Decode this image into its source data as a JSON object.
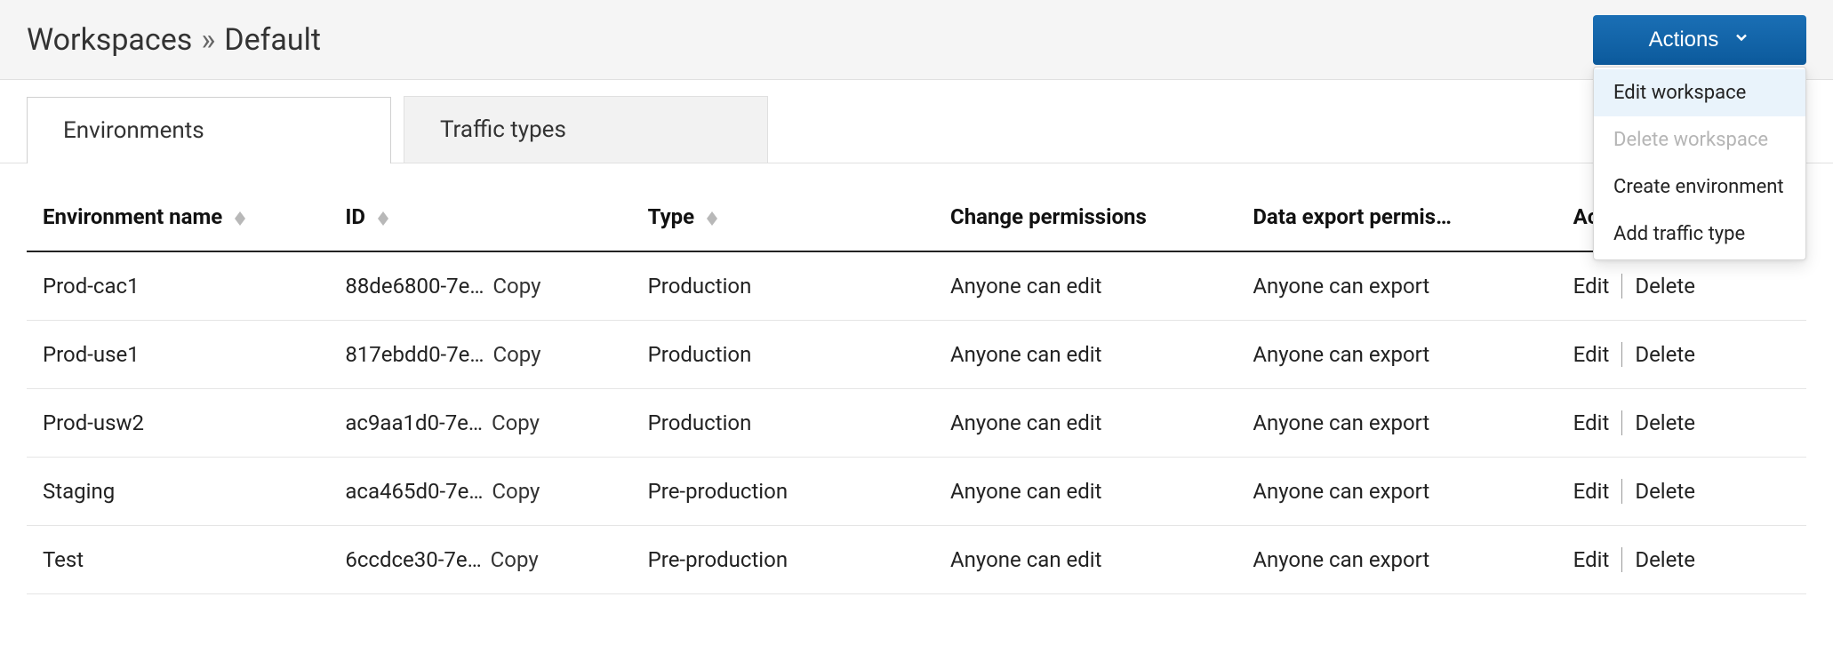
{
  "header": {
    "breadcrumb_root": "Workspaces",
    "breadcrumb_sep": "»",
    "breadcrumb_current": "Default",
    "actions_label": "Actions"
  },
  "dropdown": {
    "items": [
      {
        "label": "Edit workspace",
        "highlight": true,
        "disabled": false
      },
      {
        "label": "Delete workspace",
        "highlight": false,
        "disabled": true
      },
      {
        "label": "Create environment",
        "highlight": false,
        "disabled": false
      },
      {
        "label": "Add traffic type",
        "highlight": false,
        "disabled": false
      }
    ]
  },
  "tabs": [
    {
      "label": "Environments",
      "active": true
    },
    {
      "label": "Traffic types",
      "active": false
    }
  ],
  "table": {
    "headers": {
      "name": "Environment name",
      "id": "ID",
      "type": "Type",
      "change": "Change permissions",
      "export": "Data export permis…",
      "actions": "Actions"
    },
    "copy_label": "Copy",
    "edit_label": "Edit",
    "delete_label": "Delete",
    "rows": [
      {
        "name": "Prod-cac1",
        "id": "88de6800-7e…",
        "type": "Production",
        "change": "Anyone can edit",
        "export": "Anyone can export"
      },
      {
        "name": "Prod-use1",
        "id": "817ebdd0-7e…",
        "type": "Production",
        "change": "Anyone can edit",
        "export": "Anyone can export"
      },
      {
        "name": "Prod-usw2",
        "id": "ac9aa1d0-7e…",
        "type": "Production",
        "change": "Anyone can edit",
        "export": "Anyone can export"
      },
      {
        "name": "Staging",
        "id": "aca465d0-7e…",
        "type": "Pre-production",
        "change": "Anyone can edit",
        "export": "Anyone can export"
      },
      {
        "name": "Test",
        "id": "6ccdce30-7e…",
        "type": "Pre-production",
        "change": "Anyone can edit",
        "export": "Anyone can export"
      }
    ]
  }
}
